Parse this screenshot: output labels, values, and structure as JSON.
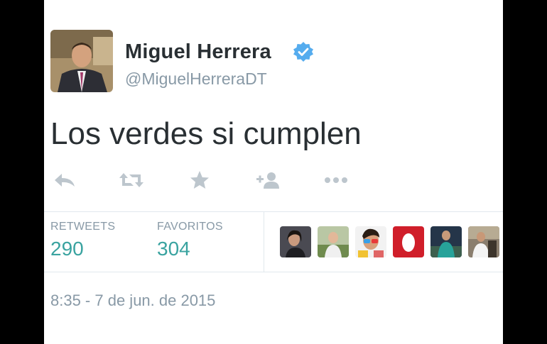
{
  "tweet": {
    "user": {
      "name": "Miguel Herrera",
      "handle": "@MiguelHerreraDT",
      "verified": true
    },
    "text": "Los verdes si cumplen",
    "actions": [
      "reply-icon",
      "retweet-icon",
      "favorite-icon",
      "follow-icon",
      "more-icon"
    ],
    "stats": {
      "retweets_label": "RETWEETS",
      "retweets_value": "290",
      "favorites_label": "FAVORITOS",
      "favorites_value": "304"
    },
    "timestamp": "8:35 - 7 de jun. de 2015"
  },
  "colors": {
    "accent_count": "#3aa3a0",
    "verified": "#55acee",
    "muted": "#8899a6",
    "action_icon": "#bdc6cd"
  }
}
